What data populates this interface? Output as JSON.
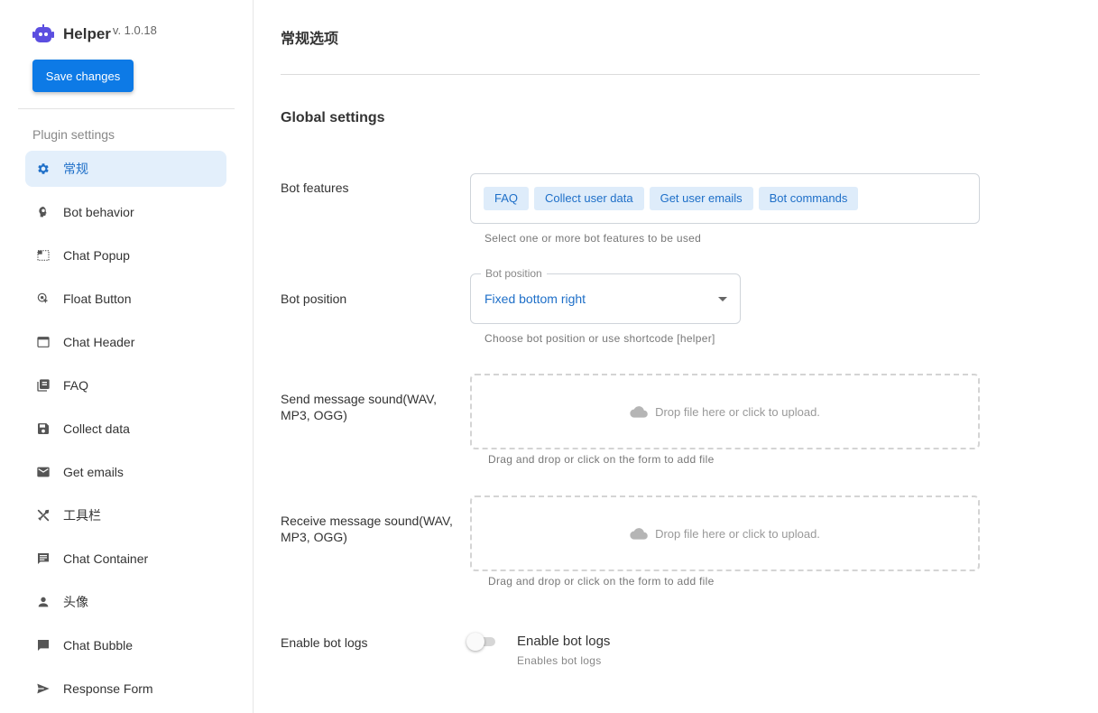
{
  "brand": {
    "name": "Helper",
    "version": "v. 1.0.18",
    "accent": "#5b4ee0"
  },
  "sidebar": {
    "save_label": "Save changes",
    "subheader": "Plugin settings",
    "items": [
      {
        "label": "常规",
        "icon": "gear-icon",
        "active": true
      },
      {
        "label": "Bot behavior",
        "icon": "brain-icon"
      },
      {
        "label": "Chat Popup",
        "icon": "popup-icon"
      },
      {
        "label": "Float Button",
        "icon": "touch-icon"
      },
      {
        "label": "Chat Header",
        "icon": "window-icon"
      },
      {
        "label": "FAQ",
        "icon": "library-icon"
      },
      {
        "label": "Collect data",
        "icon": "save-icon"
      },
      {
        "label": "Get emails",
        "icon": "mail-icon"
      },
      {
        "label": "工具栏",
        "icon": "tools-icon"
      },
      {
        "label": "Chat Container",
        "icon": "message-icon"
      },
      {
        "label": "头像",
        "icon": "person-icon"
      },
      {
        "label": "Chat Bubble",
        "icon": "bubble-icon"
      },
      {
        "label": "Response Form",
        "icon": "send-icon"
      }
    ]
  },
  "main": {
    "section_title": "常规选项",
    "group_title": "Global settings",
    "bot_features": {
      "label": "Bot features",
      "chips": [
        "FAQ",
        "Collect user data",
        "Get user emails",
        "Bot commands"
      ],
      "helper": "Select one or more bot features to be used"
    },
    "bot_position": {
      "label": "Bot position",
      "legend": "Bot position",
      "value": "Fixed bottom right",
      "helper": "Choose bot position or use shortcode [helper]"
    },
    "send_sound": {
      "label": "Send message sound(WAV, MP3, OGG)",
      "drop_text": "Drop file here or click to upload.",
      "helper": "Drag and drop or click on the form to add file"
    },
    "receive_sound": {
      "label": "Receive message sound(WAV, MP3, OGG)",
      "drop_text": "Drop file here or click to upload.",
      "helper": "Drag and drop or click on the form to add file"
    },
    "bot_logs": {
      "label": "Enable bot logs",
      "toggle_label": "Enable bot logs",
      "toggle_sub": "Enables bot logs",
      "enabled": false
    }
  },
  "colors": {
    "primary": "#0d7ae6",
    "chip_bg": "#deecfa",
    "chip_text": "#1e6fc8",
    "active_nav_bg": "#e3effb"
  }
}
